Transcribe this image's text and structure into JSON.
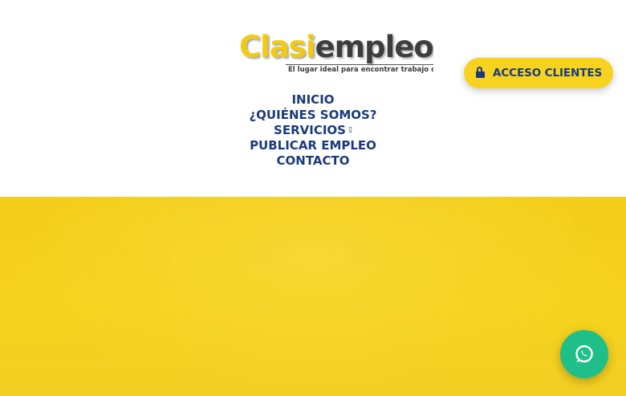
{
  "logo": {
    "part1": "Clasi",
    "part2": "empleos",
    "tagline": "El lugar ideal para encontrar trabajo o tr"
  },
  "nav": {
    "items": [
      {
        "label": "INICIO"
      },
      {
        "label": "¿QUIÉNES SOMOS?"
      },
      {
        "label": "SERVICIOS",
        "has_dropdown": true
      },
      {
        "label": "PUBLICAR EMPLEO"
      },
      {
        "label": "CONTACTO"
      }
    ]
  },
  "access_button": {
    "label": "ACCESO CLIENTES",
    "icon": "lock-icon"
  },
  "whatsapp": {
    "icon": "whatsapp-icon"
  },
  "colors": {
    "brand_yellow": "#f4d21d",
    "brand_navy": "#1a3a7a",
    "whatsapp_green": "#1fbf8a"
  }
}
